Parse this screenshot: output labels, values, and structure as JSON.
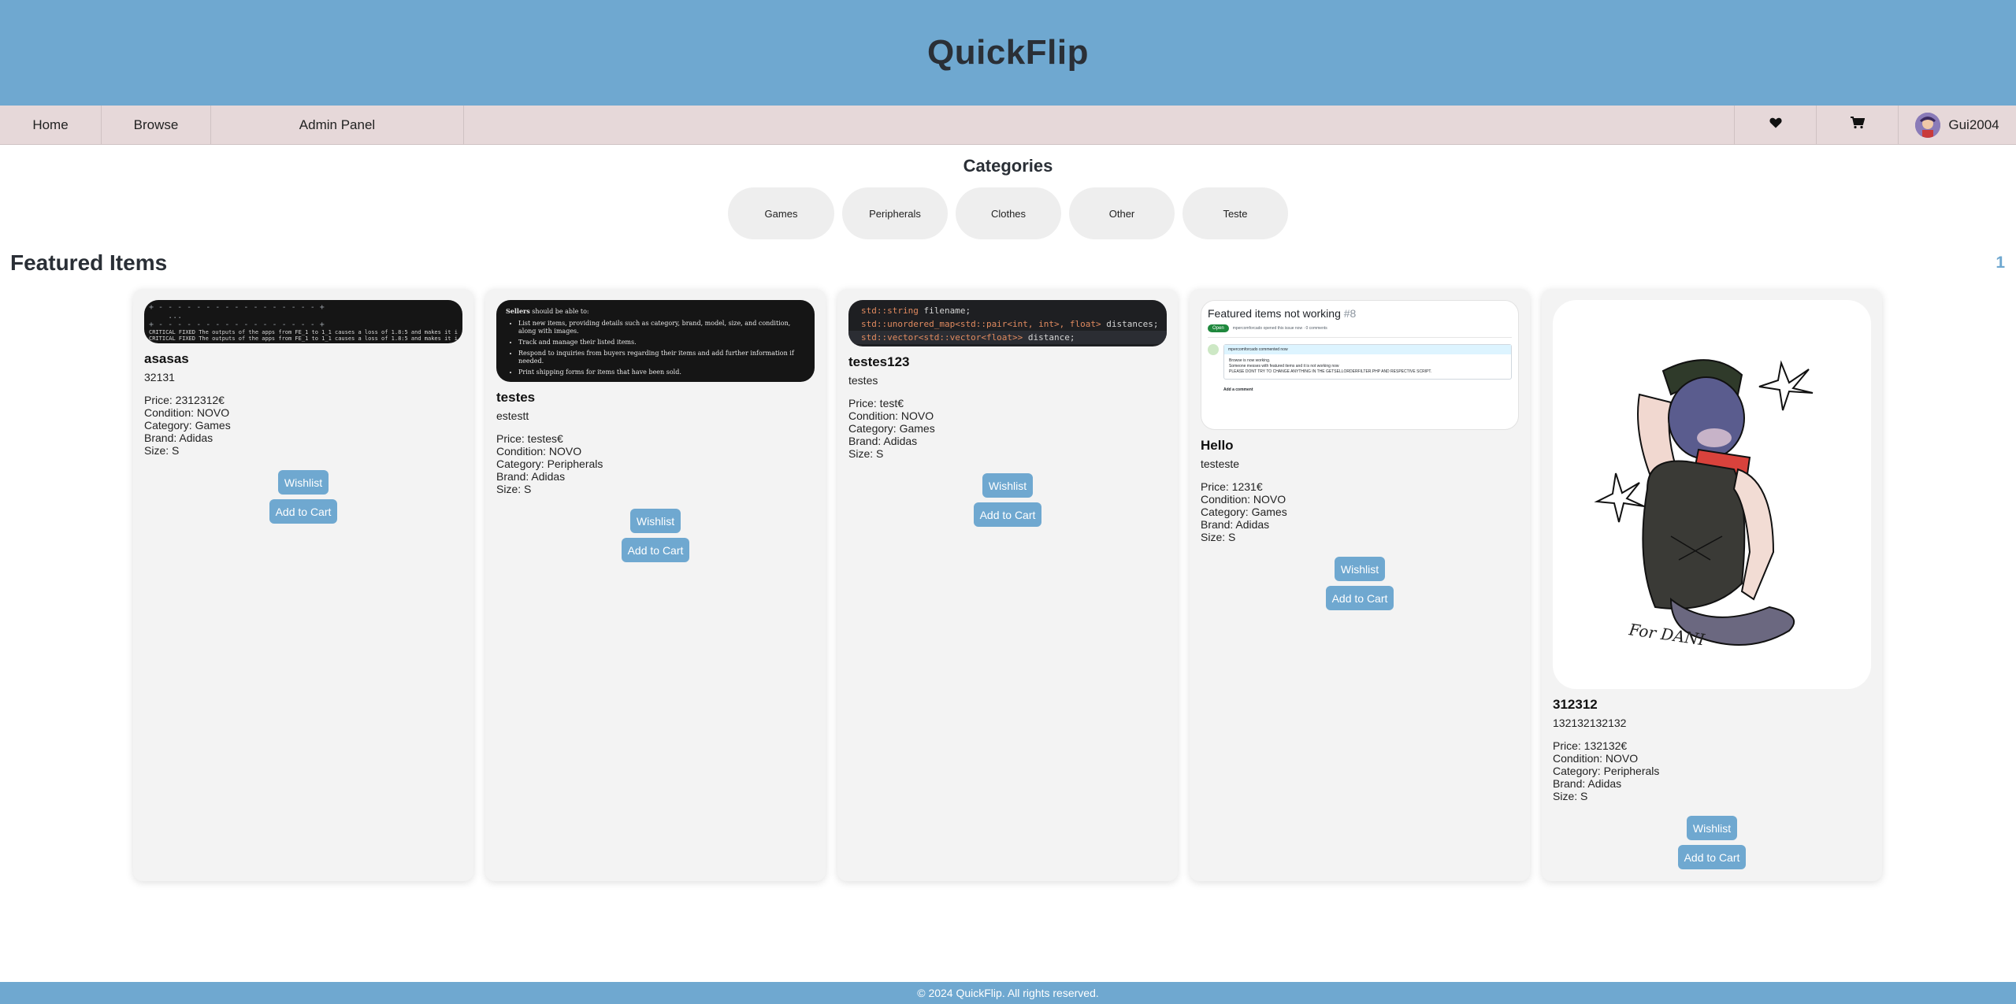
{
  "app": {
    "title": "QuickFlip"
  },
  "nav": {
    "home": "Home",
    "browse": "Browse",
    "admin": "Admin Panel",
    "username": "Gui2004"
  },
  "categories": {
    "heading": "Categories",
    "items": [
      "Games",
      "Peripherals",
      "Clothes",
      "Other",
      "Teste"
    ]
  },
  "featured": {
    "heading": "Featured Items",
    "page": "1",
    "wishlist_label": "Wishlist",
    "cart_label": "Add to Cart",
    "items": [
      {
        "title": "asasas",
        "description": "32131",
        "price": "Price: 2312312€",
        "condition": "Condition: NOVO",
        "category": "Category: Games",
        "brand": "Brand: Adidas",
        "size": "Size: S"
      },
      {
        "title": "testes",
        "description": "estestt",
        "price": "Price: testes€",
        "condition": "Condition: NOVO",
        "category": "Category: Peripherals",
        "brand": "Brand: Adidas",
        "size": "Size: S"
      },
      {
        "title": "testes123",
        "description": "testes",
        "price": "Price: test€",
        "condition": "Condition: NOVO",
        "category": "Category: Games",
        "brand": "Brand: Adidas",
        "size": "Size: S"
      },
      {
        "title": "Hello",
        "description": "testeste",
        "price": "Price: 1231€",
        "condition": "Condition: NOVO",
        "category": "Category: Games",
        "brand": "Brand: Adidas",
        "size": "Size: S"
      },
      {
        "title": "312312",
        "description": "132132132132",
        "price": "Price: 132132€",
        "condition": "Condition: NOVO",
        "category": "Category: Peripherals",
        "brand": "Brand: Adidas",
        "size": "Size: S"
      }
    ]
  },
  "thumbs": {
    "sellers_bold": "Sellers",
    "sellers_rest": " should be able to:",
    "sellers_bullets": [
      "List new items, providing details such as category, brand, model, size, and condition, along with images.",
      "Track and manage their listed items.",
      "Respond to inquiries from buyers regarding their items and add further information if needed.",
      "Print shipping forms for items that have been sold."
    ],
    "code_lines": [
      {
        "type": "std::string",
        "rest": " filename;"
      },
      {
        "type": "std::unordered_map<std::pair<int, int>, float>",
        "rest": " distances;"
      },
      {
        "type": "std::vector<std::vector<float>>",
        "rest": " distance;"
      }
    ],
    "issue_title": "Featured items not working",
    "issue_number": "#8",
    "issue_state": "Open",
    "issue_meta": "mpercomforcado opened this issue now · 0 comments",
    "comment_author": "mpercomforcado commented now",
    "comment_lines": [
      "Browse is now working.",
      "Someone messes with featured items and it is not working now",
      "PLEASE DONT TRY TO CHANGE ANYTHING IN THE GETSELLORDERFILTER.PHP AND RESPECTIVE SCRIPT."
    ],
    "add_comment": "Add a comment",
    "terminal_lines": [
      "CRITICAL FIXED The outputs of the apps from FE_1 to 1_1 causes a loss of 1.8:5 and makes it impossible to deliver the desired amount of paper",
      "CRITICAL FIXED The outputs of the apps from FE_1 to 1_1 causes a loss of 1.8:5 and makes it impossible to deliver the desired amount of paper"
    ],
    "art_caption": "For DANI"
  },
  "footer": {
    "text": "© 2024 QuickFlip. All rights reserved."
  },
  "colors": {
    "header_bg": "#6fa8d0",
    "nav_bg": "#e6d8d9",
    "button_bg": "#6fa8d0",
    "card_bg": "#f3f3f3",
    "pill_bg": "#eeeeee"
  }
}
